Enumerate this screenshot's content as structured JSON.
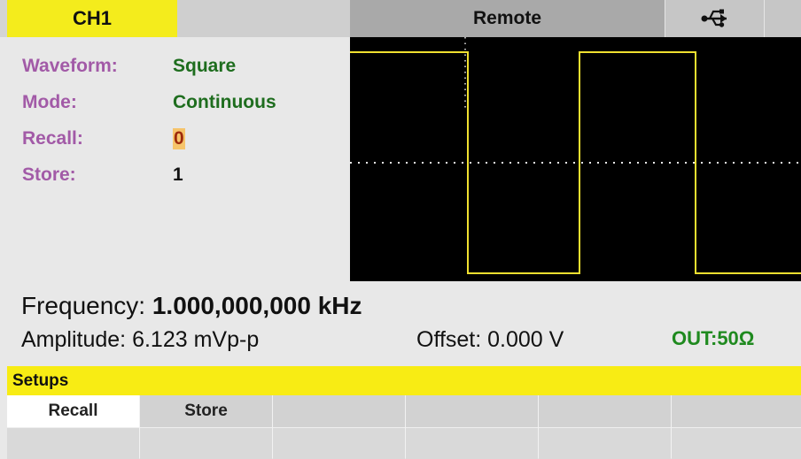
{
  "header": {
    "channel": "CH1",
    "status": "Remote",
    "connection_icon": "usb-icon"
  },
  "params": [
    {
      "label": "Waveform:",
      "value": "Square"
    },
    {
      "label": "Mode:",
      "value": "Continuous"
    },
    {
      "label": "Recall:",
      "value": "0"
    },
    {
      "label": "Store:",
      "value": "1"
    }
  ],
  "waveform_display": {
    "shape": "square",
    "trace_color": "#f0e030",
    "background": "#000000"
  },
  "readouts": {
    "frequency_label": "Frequency:",
    "frequency_value": "1.000,000,000 kHz",
    "amplitude_label": "Amplitude:",
    "amplitude_value": "6.123 mVp-p",
    "offset_label": "Offset:",
    "offset_value": "0.000 V",
    "output": "OUT:50Ω"
  },
  "menu": {
    "title": "Setups",
    "softkeys": [
      "Recall",
      "Store",
      "",
      "",
      "",
      ""
    ],
    "active": "Recall"
  },
  "colors": {
    "accent_yellow": "#f4ec1c",
    "label_purple": "#a25aa7",
    "value_green": "#1e6d1e"
  }
}
